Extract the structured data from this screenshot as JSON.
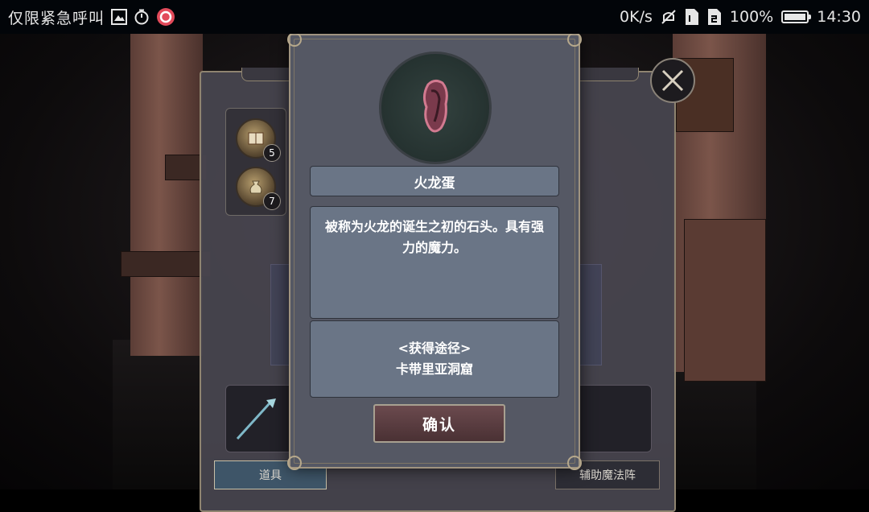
{
  "status_bar": {
    "carrier": "仅限紧急呼叫",
    "net_speed": "0K/s",
    "battery_percent": "100%",
    "battery_level": 1.0,
    "time": "14:30",
    "icons": [
      "gallery-icon",
      "timer-icon",
      "app-notification-icon",
      "mute-icon",
      "sim1-icon",
      "sim2-icon",
      "battery-icon"
    ]
  },
  "inventory": {
    "slots": [
      {
        "icon": "spellbook-icon",
        "count": "5"
      },
      {
        "icon": "pouch-icon",
        "count": "7"
      }
    ],
    "tabs": [
      {
        "label": "道具",
        "active": true
      },
      {
        "label": "辅助魔法阵",
        "active": false
      }
    ]
  },
  "dialog": {
    "item_icon": "fire-dragon-egg-icon",
    "item_name": "火龙蛋",
    "description": "被称为火龙的诞生之初的石头。具有强力的魔力。",
    "source_title": "<获得途径>",
    "source_value": "卡带里亚洞窟",
    "confirm_label": "确认"
  },
  "colors": {
    "panel_bg": "#555864",
    "box_bg": "#6a7586",
    "border_gold": "#a09480",
    "button_bg": "#5a3d41"
  }
}
